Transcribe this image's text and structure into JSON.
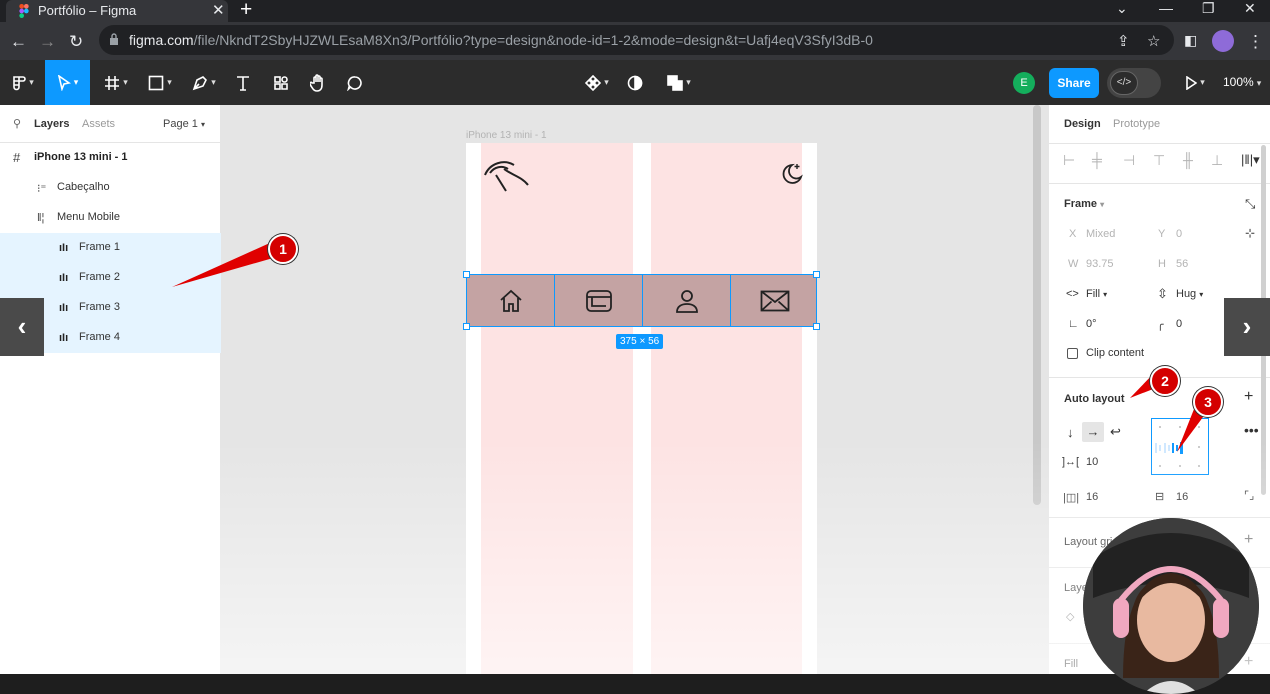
{
  "browser": {
    "tab_title": "Portfólio – Figma",
    "url_host": "figma.com",
    "url_path": "/file/NkndT2SbyHJZWLEsaM8Xn3/Portfólio?type=design&node-id=1-2&mode=design&t=Uafj4eqV3SfyI3dB-0"
  },
  "toolbar": {
    "avatar_initial": "E",
    "share_label": "Share",
    "zoom": "100%",
    "tools": [
      "figma-menu-icon",
      "move-icon",
      "frame-icon",
      "rectangle-icon",
      "pen-icon",
      "text-icon",
      "resources-icon",
      "hand-icon",
      "comment-icon"
    ],
    "center_tools": [
      "component-icon",
      "mask-icon",
      "boolean-icon"
    ],
    "accent": "#0d99ff"
  },
  "layers_panel": {
    "tab_layers": "Layers",
    "tab_assets": "Assets",
    "page": "Page 1",
    "items": [
      {
        "label": "iPhone 13 mini - 1",
        "icon": "frame-hash-icon",
        "selected": false
      },
      {
        "label": "Cabeçalho",
        "icon": "autolayout-vertical-icon",
        "selected": false
      },
      {
        "label": "Menu Mobile",
        "icon": "autolayout-horizontal-icon",
        "selected": false
      },
      {
        "label": "Frame 1",
        "icon": "autolayout-bars-icon",
        "selected": true
      },
      {
        "label": "Frame 2",
        "icon": "autolayout-bars-icon",
        "selected": true
      },
      {
        "label": "Frame 3",
        "icon": "autolayout-bars-icon",
        "selected": true
      },
      {
        "label": "Frame 4",
        "icon": "autolayout-bars-icon",
        "selected": true
      }
    ]
  },
  "canvas": {
    "frame_label": "iPhone 13 mini - 1",
    "dimension_badge": "375 × 56",
    "nav_icons": [
      "home-icon",
      "browser-window-icon",
      "user-icon",
      "mail-icon"
    ],
    "header_icons": [
      "rainbow-logo-icon",
      "moon-stars-icon"
    ],
    "column_color": "#fde3e3",
    "navbar_color": "#c4a3a3"
  },
  "design_panel": {
    "tab_design": "Design",
    "tab_prototype": "Prototype",
    "frame_section": "Frame",
    "x_label": "X",
    "x_value": "Mixed",
    "y_label": "Y",
    "y_value": "0",
    "w_label": "W",
    "w_value": "93.75",
    "h_label": "H",
    "h_value": "56",
    "fill_mode": "Fill",
    "hug_mode": "Hug",
    "rotation": "0°",
    "radius": "0",
    "clip_content": "Clip content",
    "auto_layout": "Auto layout",
    "gap": "10",
    "padding_h": "16",
    "padding_v": "16",
    "layout_grid": "Layout grid",
    "layer": "Layer",
    "fill": "Fill"
  },
  "annotations": [
    "1",
    "2",
    "3"
  ]
}
